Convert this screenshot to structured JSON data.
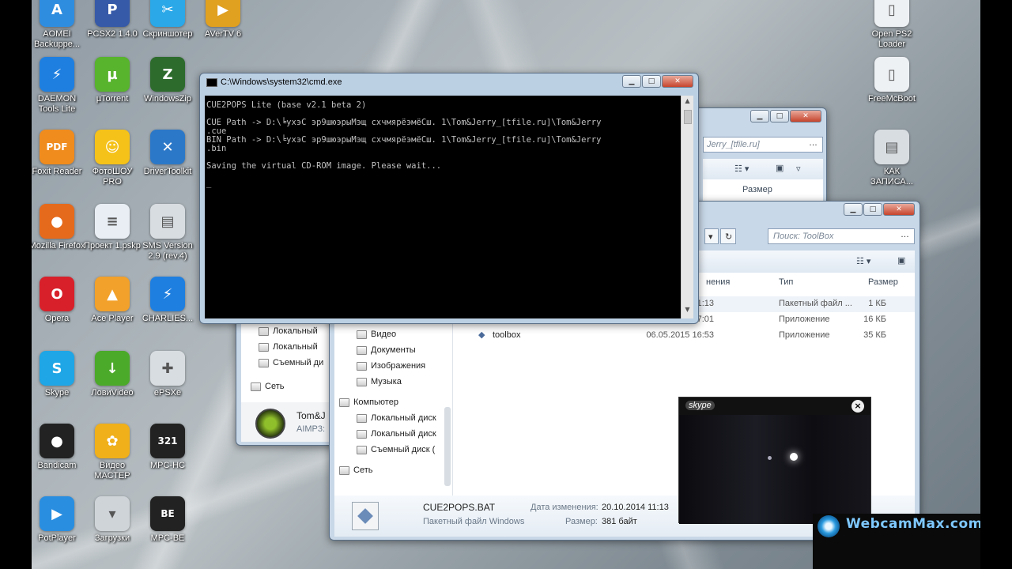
{
  "desktop_icons": [
    {
      "label": "AOMEI Backuppe...",
      "icon": "aomei-icon",
      "color": "#2f8de0"
    },
    {
      "label": "PCSX2 1.4.0",
      "icon": "pcsx2-icon",
      "color": "#3659a8"
    },
    {
      "label": "Скриншотер",
      "icon": "screenshot-icon",
      "color": "#2aa8e8"
    },
    {
      "label": "AVerTV 6",
      "icon": "avertv-icon",
      "color": "#e0a020"
    },
    {
      "label": "DAEMON Tools Lite",
      "icon": "daemon-tools-icon",
      "color": "#1f7fe0"
    },
    {
      "label": "µTorrent",
      "icon": "utorrent-icon",
      "color": "#58b32d"
    },
    {
      "label": "WindowsZip",
      "icon": "windowszip-icon",
      "color": "#2d6b2d"
    },
    {
      "label": "Foxit Reader",
      "icon": "foxit-icon",
      "color": "#f08c1e"
    },
    {
      "label": "ФотоШОУ PRO",
      "icon": "fotoshow-icon",
      "color": "#f5c21a"
    },
    {
      "label": "DriverToolkit",
      "icon": "drivertoolkit-icon",
      "color": "#2c78c8"
    },
    {
      "label": "Mozilla Firefox",
      "icon": "firefox-icon",
      "color": "#e66a1c"
    },
    {
      "label": "Проект 1.pskp",
      "icon": "document-icon",
      "color": "#e8eef4"
    },
    {
      "label": "SMS Version 2.9 (rev.4)",
      "icon": "folder-icon",
      "color": "#d8dde2"
    },
    {
      "label": "Opera",
      "icon": "opera-icon",
      "color": "#d8202a"
    },
    {
      "label": "Ace Player",
      "icon": "aceplayer-icon",
      "color": "#f2a12a"
    },
    {
      "label": "CHARLIES...",
      "icon": "daemon-tools-icon",
      "color": "#1f7fe0"
    },
    {
      "label": "Skype",
      "icon": "skype-icon",
      "color": "#1ea6e6"
    },
    {
      "label": "ЛовиVideo",
      "icon": "lovivideo-icon",
      "color": "#4caa2a"
    },
    {
      "label": "ePSXe",
      "icon": "gamepad-icon",
      "color": "#d8dde2"
    },
    {
      "label": "Bandicam",
      "icon": "bandicam-icon",
      "color": "#222222"
    },
    {
      "label": "Видео МАСТЕР",
      "icon": "videomaster-icon",
      "color": "#f0b01a"
    },
    {
      "label": "MPC-HC",
      "icon": "mpc-hc-icon",
      "color": "#222222"
    },
    {
      "label": "PotPlayer",
      "icon": "potplayer-icon",
      "color": "#2a8ee0"
    },
    {
      "label": "Загрузки",
      "icon": "downloads-folder-icon",
      "color": "#cfd4d9"
    },
    {
      "label": "MPC-BE",
      "icon": "mpc-be-icon",
      "color": "#222222"
    },
    {
      "label": "Open PS2 Loader",
      "icon": "file-icon",
      "color": "#eef1f4"
    },
    {
      "label": "FreeMcBoot",
      "icon": "file-icon",
      "color": "#eef1f4"
    },
    {
      "label": "КАК ЗАПИСА...",
      "icon": "folder-icon",
      "color": "#d8dde2"
    }
  ],
  "cmd": {
    "title": "C:\\Windows\\system32\\cmd.exe",
    "lines": "CUE2POPS Lite (base v2.1 beta 2)\n\nCUE Path -> D:\\╘ухэС эр9шюэрыМэщ схчмярёэмёСш. 1\\Tom&Jerry_[tfile.ru]\\Tom&Jerry\n.cue\nBIN Path -> D:\\╘ухэС эр9шюэрыМэщ схчмярёэмёСш. 1\\Tom&Jerry_[tfile.ru]\\Tom&Jerry\n.bin\n\nSaving the virtual CD-ROM image. Please wait...\n\n_"
  },
  "explorer_back": {
    "path_partial": "Jerry_[tfile.ru]",
    "col_size": "Размер",
    "nav": [
      "Локальный",
      "Локальный",
      "Съемный ди",
      "Сеть"
    ],
    "player_title": "Tom&J",
    "player_sub": "AIMP3:"
  },
  "explorer_front": {
    "search_placeholder": "Поиск: ToolBox",
    "headers": {
      "date": "нения",
      "type": "Тип",
      "size": "Размер"
    },
    "nav": [
      {
        "label": "Видео",
        "indent": true
      },
      {
        "label": "Документы",
        "indent": true
      },
      {
        "label": "Изображения",
        "indent": true
      },
      {
        "label": "Музыка",
        "indent": true
      },
      {
        "label": "Компьютер",
        "indent": false
      },
      {
        "label": "Локальный диск",
        "indent": true
      },
      {
        "label": "Локальный диск",
        "indent": true
      },
      {
        "label": "Съемный диск (",
        "indent": true
      },
      {
        "label": "Сеть",
        "indent": false
      }
    ],
    "rows": [
      {
        "name": "",
        "date": "11:13",
        "type": "Пакетный файл ...",
        "size": "1 КБ"
      },
      {
        "name": "",
        "date": "17:01",
        "type": "Приложение",
        "size": "16 КБ"
      },
      {
        "name": "toolbox",
        "date": "06.05.2015 16:53",
        "type": "Приложение",
        "size": "35 КБ"
      }
    ],
    "details": {
      "filename": "CUE2POPS.BAT",
      "filetype": "Пакетный файл Windows",
      "modified_label": "Дата изменения:",
      "modified_value": "20.10.2014 11:13",
      "size_label": "Размер:",
      "size_value": "381 байт",
      "cut_letter": "Д"
    }
  },
  "skype": {
    "logo": "skype"
  },
  "watermark": {
    "text": "WebcamMax.com"
  },
  "colors": {
    "window_frame": "#c9d8e8",
    "console_bg": "#000000",
    "console_text": "#c0c0c0"
  }
}
